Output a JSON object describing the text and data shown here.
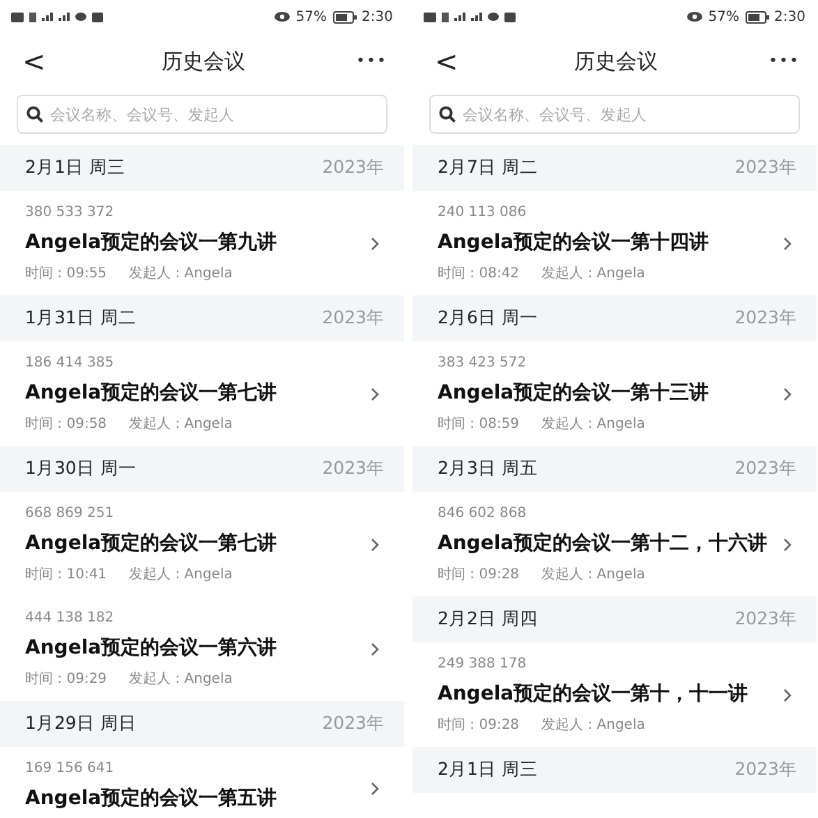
{
  "panels": [
    {
      "status_bar": {
        "battery": "57%",
        "time": "2:30"
      },
      "nav": {
        "back": "<",
        "title": "历史会议",
        "more": "•••"
      },
      "search": {
        "placeholder": "会议名称、会议号、发起人"
      },
      "groups": [
        {
          "date": "2月1日 周三",
          "year": "2023年",
          "meetings": [
            {
              "number": "380 533 372",
              "title": "Angela预定的会议一第九讲",
              "time": "时间 : 09:55",
              "host": "发起人 : Angela"
            }
          ]
        },
        {
          "date": "1月31日 周二",
          "year": "2023年",
          "meetings": [
            {
              "number": "186 414 385",
              "title": "Angela预定的会议一第七讲",
              "time": "时间 : 09:58",
              "host": "发起人 : Angela"
            }
          ]
        },
        {
          "date": "1月30日 周一",
          "year": "2023年",
          "meetings": [
            {
              "number": "668 869 251",
              "title": "Angela预定的会议一第七讲",
              "time": "时间 : 10:41",
              "host": "发起人 : Angela"
            },
            {
              "number": "444 138 182",
              "title": "Angela预定的会议一第六讲",
              "time": "时间 : 09:29",
              "host": "发起人 : Angela"
            }
          ]
        },
        {
          "date": "1月29日 周日",
          "year": "2023年",
          "meetings": [
            {
              "number": "169 156 641",
              "title": "Angela预定的会议一第五讲"
            }
          ]
        }
      ]
    },
    {
      "status_bar": {
        "battery": "57%",
        "time": "2:30"
      },
      "nav": {
        "back": "<",
        "title": "历史会议",
        "more": "•••"
      },
      "search": {
        "placeholder": "会议名称、会议号、发起人"
      },
      "groups": [
        {
          "date": "2月7日 周二",
          "year": "2023年",
          "meetings": [
            {
              "number": "240 113 086",
              "title": "Angela预定的会议一第十四讲",
              "time": "时间 : 08:42",
              "host": "发起人 : Angela"
            }
          ]
        },
        {
          "date": "2月6日 周一",
          "year": "2023年",
          "meetings": [
            {
              "number": "383 423 572",
              "title": "Angela预定的会议一第十三讲",
              "time": "时间 : 08:59",
              "host": "发起人 : Angela"
            }
          ]
        },
        {
          "date": "2月3日 周五",
          "year": "2023年",
          "meetings": [
            {
              "number": "846 602 868",
              "title": "Angela预定的会议一第十二，十六讲",
              "time": "时间 : 09:28",
              "host": "发起人 : Angela"
            }
          ]
        },
        {
          "date": "2月2日 周四",
          "year": "2023年",
          "meetings": [
            {
              "number": "249 388 178",
              "title": "Angela预定的会议一第十，十一讲",
              "time": "时间 : 09:28",
              "host": "发起人 : Angela"
            }
          ]
        },
        {
          "date": "2月1日 周三",
          "year": "2023年"
        }
      ]
    }
  ]
}
